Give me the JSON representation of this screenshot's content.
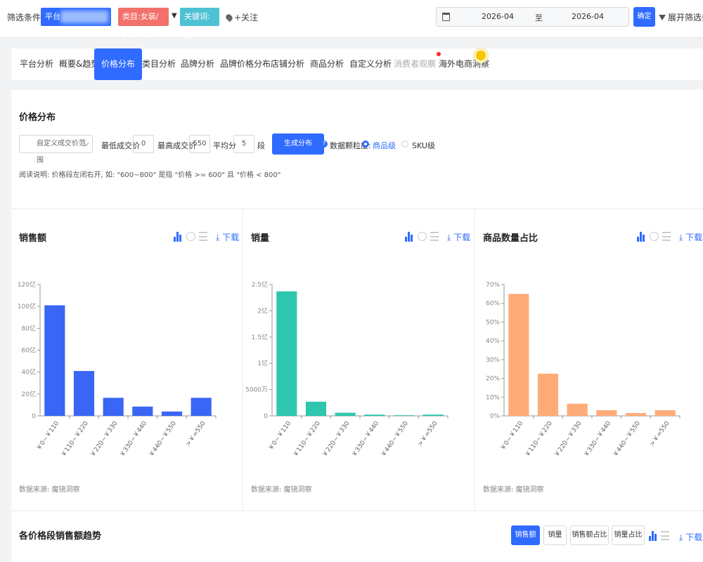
{
  "filter": {
    "label": "筛选条件:",
    "platform_chip": "平台",
    "category_chip": "类目:女装/女士精品",
    "keyword_chip": "关键词: 上衣",
    "follow": "+关注",
    "date_from": "2026-04",
    "date_to_word": "至",
    "date_to": "2026-04",
    "confirm": "确定",
    "expand": "展开筛选条件"
  },
  "tabs": [
    {
      "label": "平台分析"
    },
    {
      "label": "概要&趋势"
    },
    {
      "label": "价格分布"
    },
    {
      "label": "类目分析"
    },
    {
      "label": "品牌分析"
    },
    {
      "label": "品牌价格分布"
    },
    {
      "label": "店铺分析"
    },
    {
      "label": "商品分析"
    },
    {
      "label": "自定义分析"
    },
    {
      "label": "消费者观察"
    },
    {
      "label": "海外电商洞察"
    }
  ],
  "price_panel": {
    "title": "价格分布",
    "select_value": "自定义成交价范围",
    "min_label": "最低成交价",
    "min_value": "0",
    "max_label": "最高成交价",
    "max_value": "550",
    "split_label": "平均分",
    "split_value": "5",
    "seg_label": "段",
    "generate": "生成分布",
    "granularity_label": "数据颗粒度:",
    "opt_item": "商品级",
    "opt_sku": "SKU级",
    "note": "阅读说明: 价格段左闭右开, 如: \"600~800\" 是指 \"价格 >= 600\" 且 \"价格 < 800\""
  },
  "common": {
    "download": "下载",
    "source": "数据来源: 魔镜洞察"
  },
  "chart_data": [
    {
      "type": "bar",
      "title": "销售额",
      "categories": [
        "￥0~￥110",
        "￥110~￥220",
        "￥220~￥330",
        "￥330~￥440",
        "￥440~￥550",
        ">￥=550"
      ],
      "values": [
        101,
        41,
        16.5,
        8.5,
        4,
        16.5
      ],
      "ylim": [
        0,
        120
      ],
      "yticks": [
        0,
        20,
        40,
        60,
        80,
        100,
        120
      ],
      "ytick_labels": [
        "0",
        "20亿",
        "40亿",
        "60亿",
        "80亿",
        "100亿",
        "120亿"
      ],
      "color": "#3a66f5"
    },
    {
      "type": "bar",
      "title": "销量",
      "categories": [
        "￥0~￥110",
        "￥110~￥220",
        "￥220~￥330",
        "￥330~￥440",
        "￥440~￥550",
        ">￥=550"
      ],
      "values": [
        2.37,
        0.27,
        0.06,
        0.025,
        0.012,
        0.025
      ],
      "ylim": [
        0,
        2.5
      ],
      "yticks": [
        0,
        0.5,
        1,
        1.5,
        2,
        2.5
      ],
      "ytick_labels": [
        "0",
        "5000万",
        "1亿",
        "1.5亿",
        "2亿",
        "2.5亿"
      ],
      "color": "#2ec7ad"
    },
    {
      "type": "bar",
      "title": "商品数量占比",
      "categories": [
        "￥0~￥110",
        "￥110~￥220",
        "￥220~￥330",
        "￥330~￥440",
        "￥440~￥550",
        ">￥=550"
      ],
      "values": [
        65,
        22.5,
        6.5,
        3,
        1.5,
        3
      ],
      "ylim": [
        0,
        70
      ],
      "yticks": [
        0,
        10,
        20,
        30,
        40,
        50,
        60,
        70
      ],
      "ytick_labels": [
        "0%",
        "10%",
        "20%",
        "30%",
        "40%",
        "50%",
        "60%",
        "70%"
      ],
      "color": "#ffab78"
    }
  ],
  "trend": {
    "title": "各价格段销售额趋势",
    "buttons": [
      {
        "label": "销售额"
      },
      {
        "label": "销量"
      },
      {
        "label": "销售额占比"
      },
      {
        "label": "销量占比"
      }
    ],
    "download": "下载"
  }
}
